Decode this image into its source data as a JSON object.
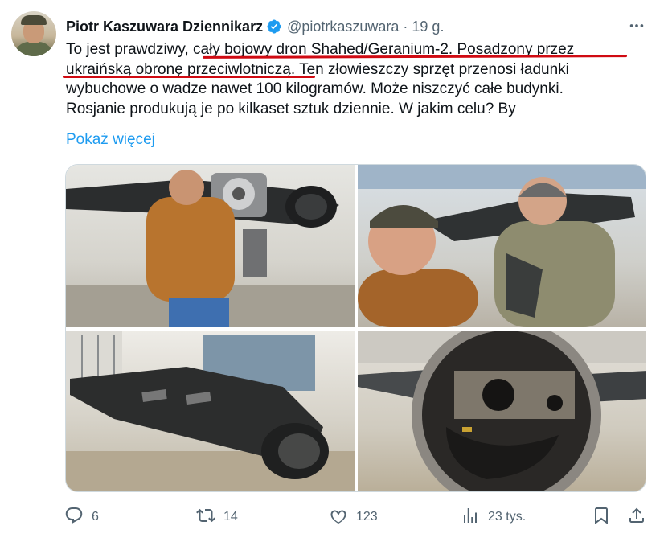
{
  "tweet": {
    "author_name": "Piotr Kaszuwara Dziennikarz",
    "handle": "@piotrkaszuwara",
    "separator": "·",
    "time": "19 g.",
    "text_lines": [
      "To jest prawdziwy, cały bojowy dron Shahed/Geranium-2. Posadzony przez",
      "ukraińską obronę przeciwlotniczą. Ten złowieszczy sprzęt przenosi ładunki",
      "wybuchowe o wadze nawet 100 kilogramów. Może niszczyć całe budynki.",
      "Rosjanie produkują je po kilkaset sztuk dziennie. W jakim celu? By"
    ],
    "show_more": "Pokaż więcej",
    "highlight_color": "#d00a12",
    "accent_color": "#1d9bf0",
    "verified_color": "#1d9bf0"
  },
  "media": {
    "photos": [
      {
        "name": "man-holding-drone-engine-photo"
      },
      {
        "name": "selfie-two-men-with-drone-photo"
      },
      {
        "name": "drone-wing-on-floor-photo"
      },
      {
        "name": "drone-rear-nozzle-photo"
      }
    ]
  },
  "actions": {
    "reply": {
      "icon": "reply-icon",
      "count": "6"
    },
    "retweet": {
      "icon": "retweet-icon",
      "count": "14"
    },
    "like": {
      "icon": "heart-icon",
      "count": "123"
    },
    "views": {
      "icon": "views-chart-icon",
      "count": "23 tys."
    },
    "bookmark": {
      "icon": "bookmark-icon"
    },
    "share": {
      "icon": "share-icon"
    }
  }
}
